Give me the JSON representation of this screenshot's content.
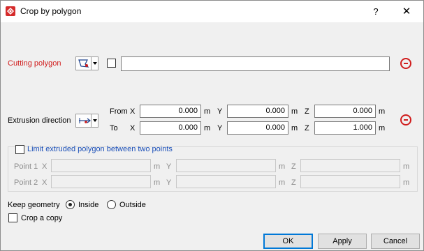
{
  "window": {
    "title": "Crop by polygon",
    "help": "?",
    "close": "✕"
  },
  "cutting_polygon": {
    "label": "Cutting polygon",
    "value": ""
  },
  "extrusion": {
    "label": "Extrusion direction",
    "from_label": "From",
    "to_label": "To",
    "x": "X",
    "y": "Y",
    "z": "Z",
    "unit": "m",
    "from": {
      "x": "0.000",
      "y": "0.000",
      "z": "0.000"
    },
    "to": {
      "x": "0.000",
      "y": "0.000",
      "z": "1.000"
    }
  },
  "limit": {
    "label": "Limit extruded polygon between two points",
    "point1_label": "Point 1",
    "point2_label": "Point 2",
    "x": "X",
    "y": "Y",
    "z": "Z",
    "unit": "m"
  },
  "keep": {
    "label": "Keep geometry",
    "inside": "Inside",
    "outside": "Outside",
    "selected": "Inside"
  },
  "crop_copy": {
    "label": "Crop a copy"
  },
  "buttons": {
    "ok": "OK",
    "apply": "Apply",
    "cancel": "Cancel"
  },
  "colors": {
    "accent_red": "#d01c1c",
    "link_blue": "#1a4fb8",
    "default_border": "#0078d7"
  }
}
